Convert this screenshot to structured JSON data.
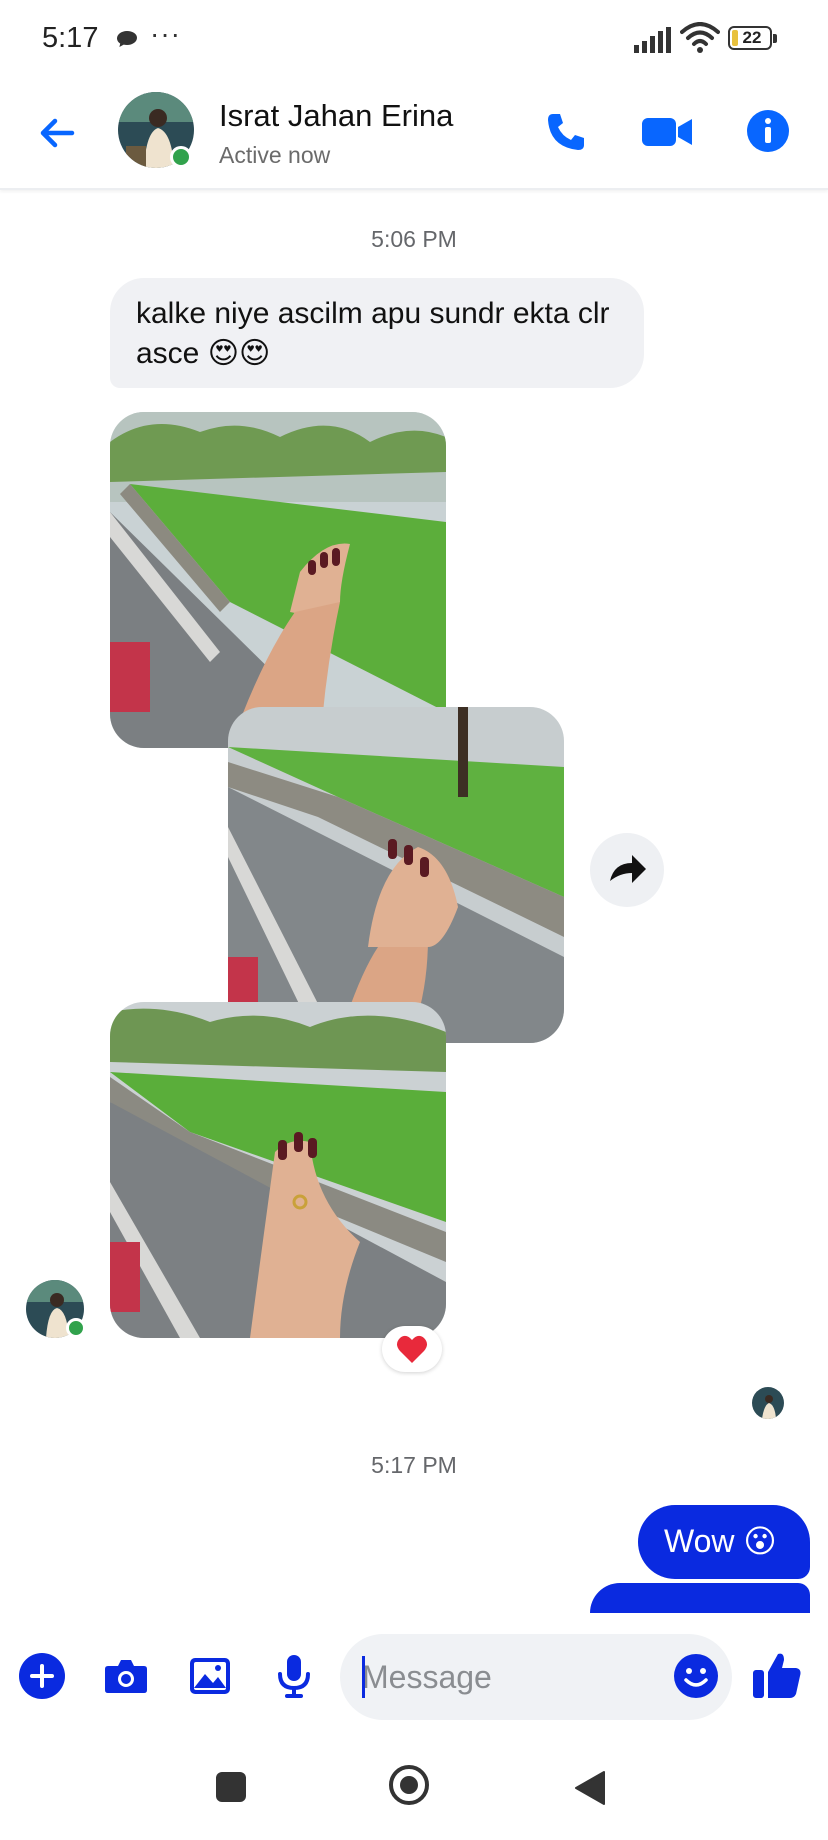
{
  "status_bar": {
    "time": "5:17",
    "dots": "···",
    "battery": "22"
  },
  "header": {
    "contact_name": "Israt Jahan Erina",
    "contact_status": "Active now",
    "icons": [
      "back-arrow-icon",
      "phone-icon",
      "video-camera-icon",
      "info-icon"
    ]
  },
  "chat": {
    "timestamp_1": "5:06 PM",
    "incoming_message": "kalke niye ascilm apu sundr ekta clr asce 😍😍",
    "photos": [
      "photo-hand-rain-1",
      "photo-hand-rain-2",
      "photo-hand-rain-3"
    ],
    "reaction": "❤️",
    "timestamp_2": "5:17 PM",
    "outgoing_message": "Wow 😮"
  },
  "composer": {
    "placeholder": "Message",
    "icons": [
      "plus-icon",
      "camera-icon",
      "gallery-icon",
      "microphone-icon",
      "emoji-icon",
      "thumbs-up-icon"
    ]
  },
  "colors": {
    "accent": "#0a2ae0",
    "header_icon_blue": "#0866ff",
    "online_green": "#31a24c"
  }
}
